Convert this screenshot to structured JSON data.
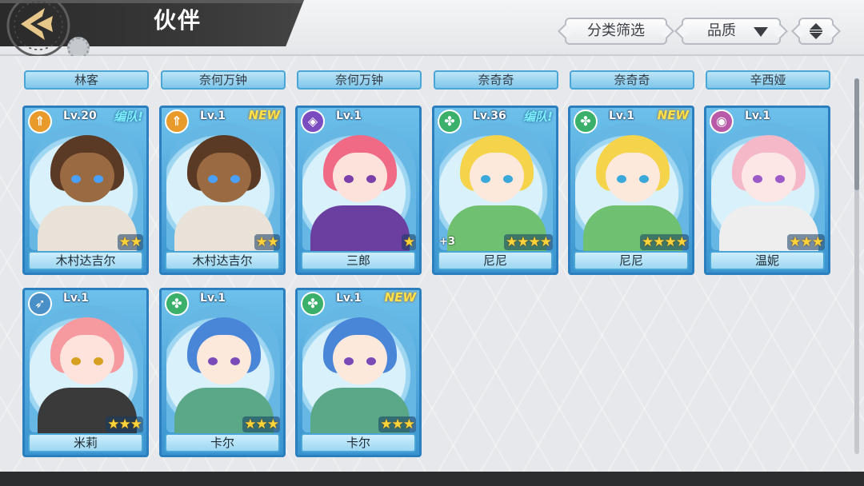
{
  "header": {
    "title": "伙伴",
    "filter_label": "分类筛选",
    "quality_label": "品质"
  },
  "top_labels": [
    "林客",
    "奈何万钟",
    "奈何万钟",
    "奈奇奇",
    "奈奇奇",
    "辛西娅"
  ],
  "cards": [
    {
      "name": "木村达吉尔",
      "level": "Lv.20",
      "tag": "编队!",
      "tag_type": "team",
      "stars": "★★",
      "class": "orange",
      "icon": "sword-icon",
      "hair": "#5a3a24",
      "skin": "#9a6a43",
      "eye": "#4aa0ff",
      "outfit": "#e8e2d8"
    },
    {
      "name": "木村达吉尔",
      "level": "Lv.1",
      "tag": "NEW",
      "tag_type": "new",
      "stars": "★★",
      "class": "orange",
      "icon": "sword-icon",
      "hair": "#5a3a24",
      "skin": "#9a6a43",
      "eye": "#4aa0ff",
      "outfit": "#e8e2d8"
    },
    {
      "name": "三郎",
      "level": "Lv.1",
      "tag": "",
      "tag_type": "",
      "stars": "★",
      "class": "purple",
      "icon": "shield-icon",
      "hair": "#f06a86",
      "skin": "#fde2dc",
      "eye": "#7a3fa8",
      "outfit": "#6a3fa0"
    },
    {
      "name": "尼尼",
      "level": "Lv.36",
      "tag": "编队!",
      "tag_type": "team",
      "stars": "★★★★",
      "plus": "+3",
      "class": "green",
      "icon": "clover-icon",
      "hair": "#f5d34a",
      "skin": "#fde8dc",
      "eye": "#3aa8d8",
      "outfit": "#6fc070"
    },
    {
      "name": "尼尼",
      "level": "Lv.1",
      "tag": "NEW",
      "tag_type": "new",
      "stars": "★★★★",
      "class": "green",
      "icon": "clover-icon",
      "hair": "#f5d34a",
      "skin": "#fde8dc",
      "eye": "#3aa8d8",
      "outfit": "#6fc070"
    },
    {
      "name": "温妮",
      "level": "Lv.1",
      "tag": "",
      "tag_type": "",
      "stars": "★★★",
      "class": "pink",
      "icon": "orb-icon",
      "hair": "#f4b8c8",
      "skin": "#fde6e6",
      "eye": "#9a5ac8",
      "outfit": "#eeeeee"
    },
    {
      "name": "米莉",
      "level": "Lv.1",
      "tag": "",
      "tag_type": "",
      "stars": "★★★",
      "class": "blue",
      "icon": "bow-icon",
      "hair": "#f79aa0",
      "skin": "#fde3dc",
      "eye": "#d8a020",
      "outfit": "#3a3a3a"
    },
    {
      "name": "卡尔",
      "level": "Lv.1",
      "tag": "",
      "tag_type": "",
      "stars": "★★★",
      "class": "green",
      "icon": "clover-icon",
      "hair": "#4a86d8",
      "skin": "#fde8dc",
      "eye": "#7a4ab8",
      "outfit": "#5aa888"
    },
    {
      "name": "卡尔",
      "level": "Lv.1",
      "tag": "NEW",
      "tag_type": "new",
      "stars": "★★★",
      "class": "green",
      "icon": "clover-icon",
      "hair": "#4a86d8",
      "skin": "#fde8dc",
      "eye": "#7a4ab8",
      "outfit": "#5aa888"
    }
  ]
}
